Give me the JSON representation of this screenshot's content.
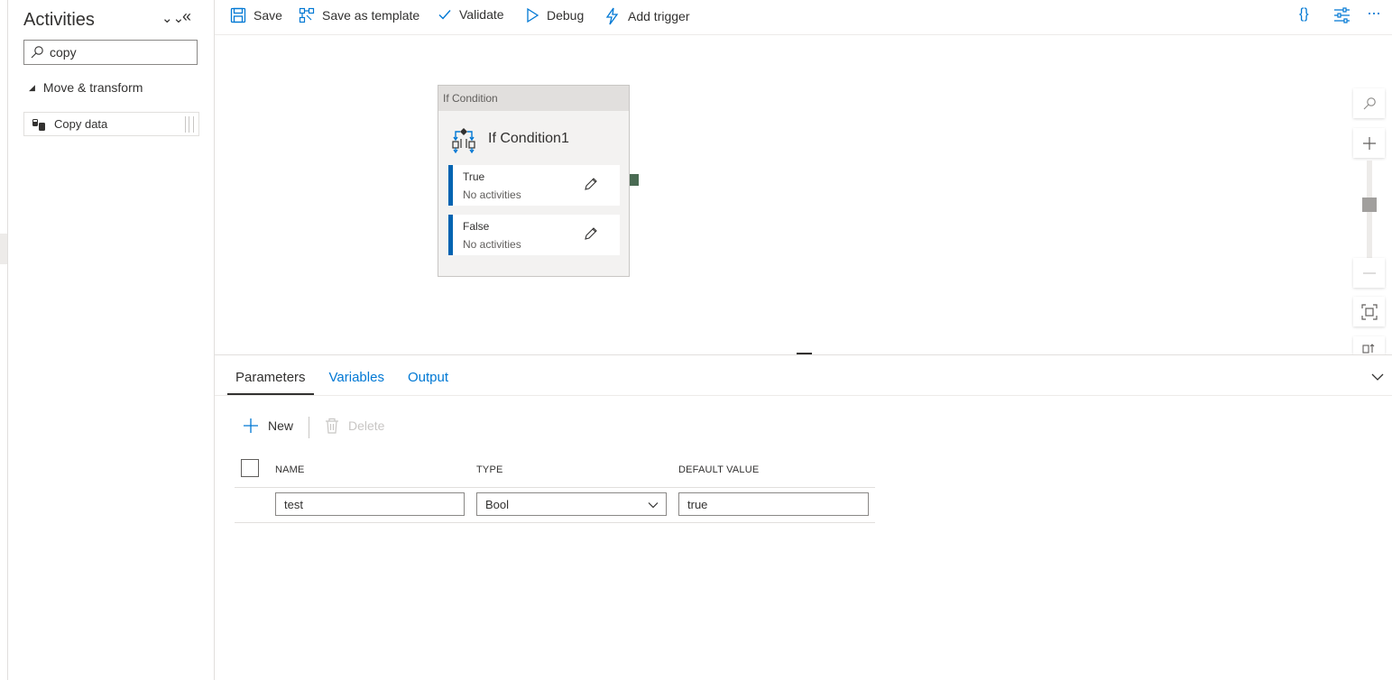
{
  "activities": {
    "title": "Activities",
    "collapse_all_glyph": "⌄⌄",
    "hide_glyph": "«",
    "search": {
      "value": "copy",
      "placeholder": ""
    },
    "category": {
      "label": "Move & transform",
      "expanded": true
    },
    "items": [
      {
        "label": "Copy data",
        "icon": "copy-data-icon"
      }
    ]
  },
  "toolbar": {
    "save": "Save",
    "save_template": "Save as template",
    "validate": "Validate",
    "debug": "Debug",
    "add_trigger": "Add trigger",
    "code_glyph": "{}",
    "more_glyph": "···"
  },
  "canvas": {
    "node": {
      "type_label": "If Condition",
      "name": "If Condition1",
      "branches": [
        {
          "name": "True",
          "status": "No activities"
        },
        {
          "name": "False",
          "status": "No activities"
        }
      ]
    },
    "zoom_level": 0.55
  },
  "panel": {
    "tabs": [
      {
        "label": "Parameters",
        "active": true
      },
      {
        "label": "Variables",
        "active": false
      },
      {
        "label": "Output",
        "active": false
      }
    ],
    "new_label": "New",
    "delete_label": "Delete",
    "columns": {
      "name": "NAME",
      "type": "TYPE",
      "default": "DEFAULT VALUE"
    },
    "rows": [
      {
        "name": "test",
        "type": "Bool",
        "default": "true"
      }
    ]
  },
  "colors": {
    "accent": "#0078d4",
    "branch_bar": "#0063b1",
    "connector": "#4a6b53"
  }
}
